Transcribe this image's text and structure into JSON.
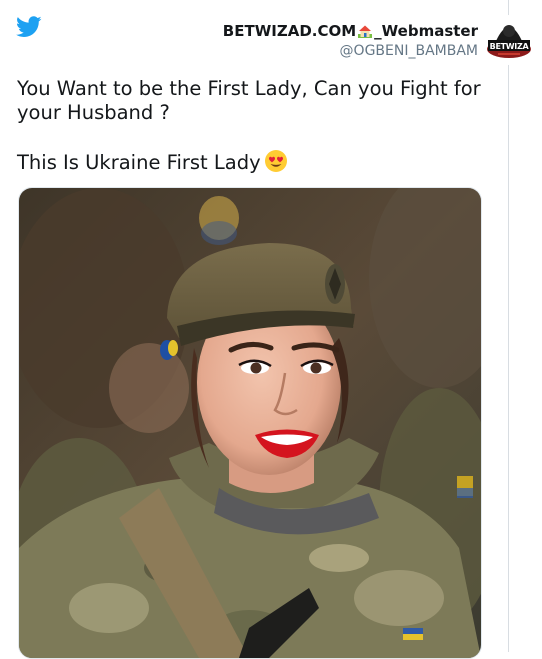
{
  "author": {
    "display_name_part1": "BETWIZAD.COM",
    "display_name_part2": "_Webmaster",
    "handle": "@OGBENI_BAMBAM",
    "avatar_text": "BETWIZA"
  },
  "tweet": {
    "line1": "You Want to be the First Lady, Can you Fight for your Husband ?",
    "line2": "This Is Ukraine First Lady"
  },
  "icons": {
    "logo": "twitter-bird-icon",
    "name_emoji": "house-emoji",
    "text_emoji": "heart-eyes-emoji"
  },
  "colors": {
    "twitter_blue": "#1da1f2",
    "text": "#14171a",
    "secondary": "#657786",
    "lipstick": "#d4141e"
  }
}
